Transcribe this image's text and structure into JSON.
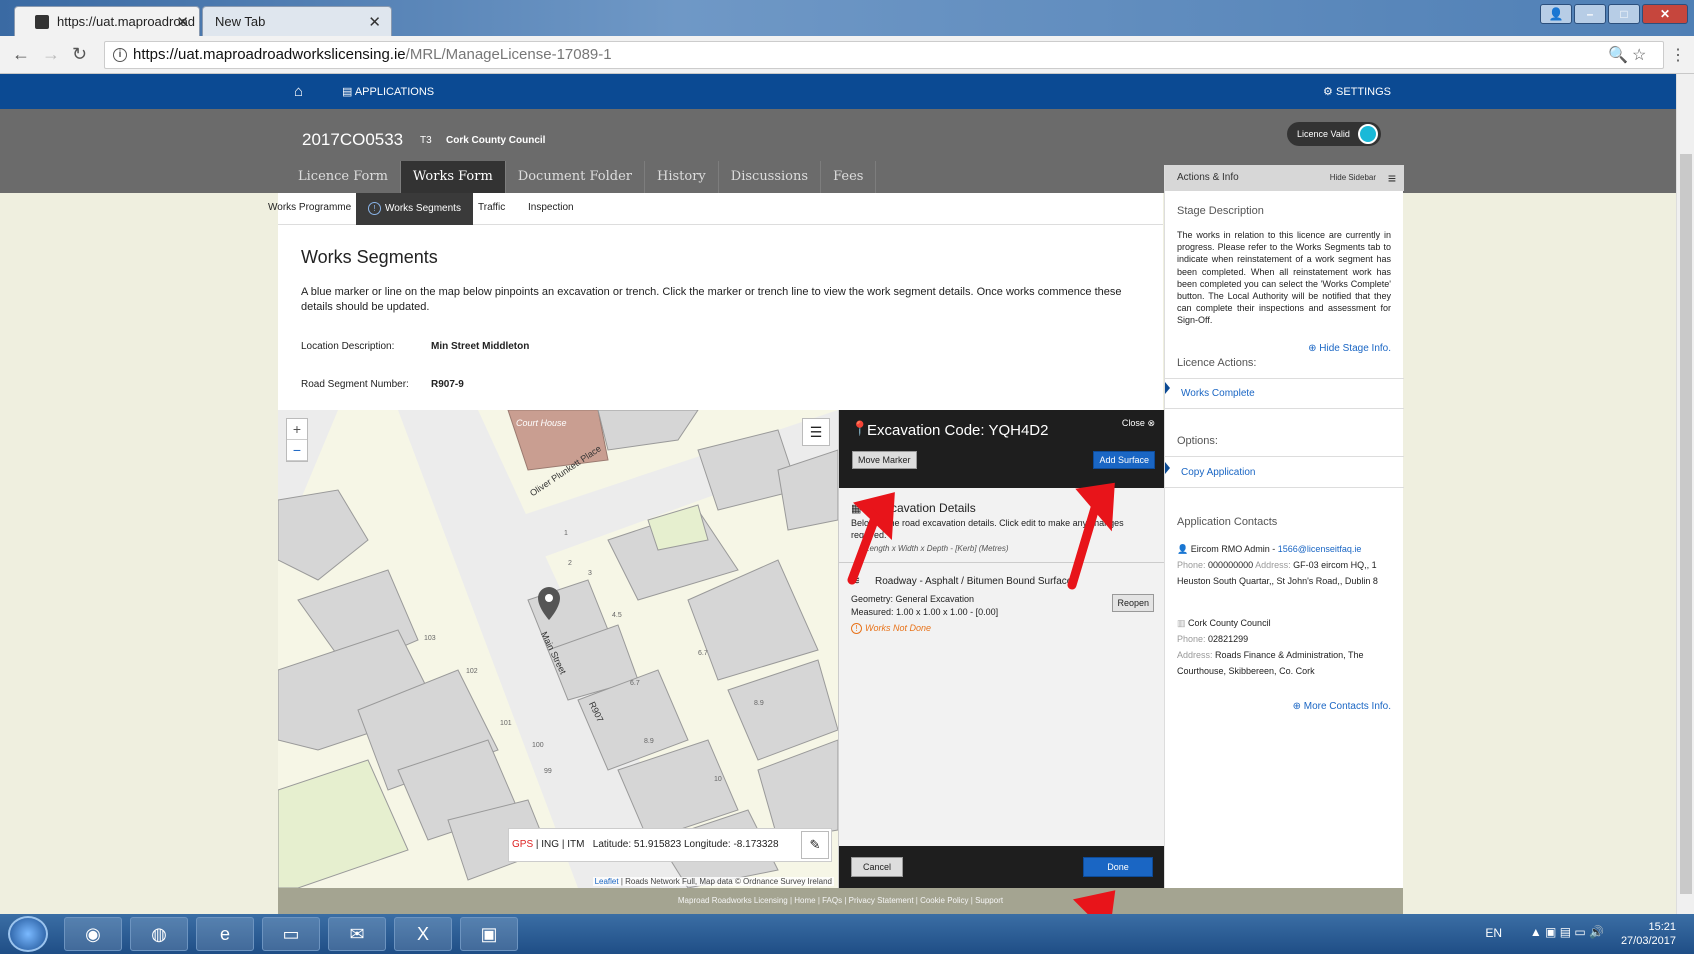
{
  "browser": {
    "tabs": [
      {
        "label": "https://uat.maproadroad",
        "active": true
      },
      {
        "label": "New Tab",
        "active": false
      }
    ],
    "url_host": "https://uat.maproadroadworkslicensing.ie",
    "url_path": "/MRL/ManageLicense-17089-1"
  },
  "nav": {
    "applications": "APPLICATIONS",
    "settings": "SETTINGS"
  },
  "licence": {
    "number": "2017CO0533",
    "tier": "T3",
    "council": "Cork County Council",
    "status": "Licence Valid"
  },
  "main_tabs": [
    "Licence Form",
    "Works Form",
    "Document Folder",
    "History",
    "Discussions",
    "Fees"
  ],
  "sub_tabs": [
    "Works Programme",
    "Works Segments",
    "Traffic",
    "Inspection"
  ],
  "works_segments": {
    "title": "Works Segments",
    "description": "A blue marker or line on the map below pinpoints an excavation or trench. Click the marker or trench line to view the work segment details. Once works commence these details should be updated.",
    "location_label": "Location Description:",
    "location_value": "Min Street Middleton",
    "road_label": "Road Segment Number:",
    "road_value": "R907-9"
  },
  "map": {
    "labels": [
      "Court House",
      "Oliver Plunkett Place",
      "Main Street",
      "R907"
    ],
    "numbers": [
      "1",
      "2",
      "3",
      "4.5",
      "6.7",
      "6.7",
      "8.9",
      "8.9",
      "10",
      "103",
      "102",
      "101",
      "100",
      "99"
    ],
    "coords": {
      "systems": [
        "GPS",
        "ING",
        "ITM"
      ],
      "readout": "Latitude: 51.915823 Longitude: -8.173328"
    },
    "attribution_leaflet": "Leaflet",
    "attribution_rest": " | Roads Network Full, Map data © Ordnance Survey Ireland"
  },
  "popup": {
    "title": "Excavation Code: YQH4D2",
    "close": "Close",
    "move_marker": "Move Marker",
    "add_surface": "Add Surface",
    "details_title": "Excavation Details",
    "details_desc": "Below is the road excavation details. Click edit to make any changes required.",
    "details_note": "Length x Width x Depth - [Kerb] (Metres)",
    "surface": "Roadway - Asphalt / Bitumen Bound Surface",
    "geometry": "Geometry: General Excavation",
    "measured": "Measured: 1.00 x 1.00 x 1.00 - [0.00]",
    "reopen": "Reopen",
    "status": "Works Not Done",
    "cancel": "Cancel",
    "done": "Done"
  },
  "sidebar": {
    "header": "Actions & Info",
    "hide": "Hide Sidebar",
    "stage_title": "Stage Description",
    "stage_text": "The works in relation to this licence are currently in progress. Please refer to the Works Segments tab to indicate when reinstatement of a work segment has been completed. When all reinstatement work has been completed you can select the 'Works Complete' button. The Local Authority will be notified that they can complete their inspections and assessment for Sign-Off.",
    "hide_stage": "Hide Stage Info.",
    "licence_actions": "Licence Actions:",
    "works_complete": "Works Complete",
    "options": "Options:",
    "copy_application": "Copy Application",
    "contacts_title": "Application Contacts",
    "contact1_name": "Eircom RMO Admin - ",
    "contact1_email": "1566@licenseitfaq.ie",
    "contact1_phone_k": "Phone:",
    "contact1_phone": "000000000",
    "contact1_address_k": "Address:",
    "contact1_address": "GF-03 eircom HQ,, 1 Heuston South Quartar,, St John's Road,, Dublin 8",
    "contact2_name": "Cork County Council",
    "contact2_phone_k": "Phone:",
    "contact2_phone": "02821299",
    "contact2_address_k": "Address:",
    "contact2_address": "Roads Finance & Administration, The Courthouse, Skibbereen, Co. Cork",
    "more_contacts": "More Contacts Info."
  },
  "footer": "Maproad Roadworks Licensing | Home | FAQs | Privacy Statement | Cookie Policy | Support",
  "taskbar": {
    "lang": "EN",
    "time": "15:21",
    "date": "27/03/2017"
  },
  "colors": {
    "brand_blue": "#0b4a93",
    "link_blue": "#1a66c4",
    "header_grey": "#6b6b6b",
    "annotation_red": "#e8141a",
    "warning_orange": "#e8731a"
  }
}
